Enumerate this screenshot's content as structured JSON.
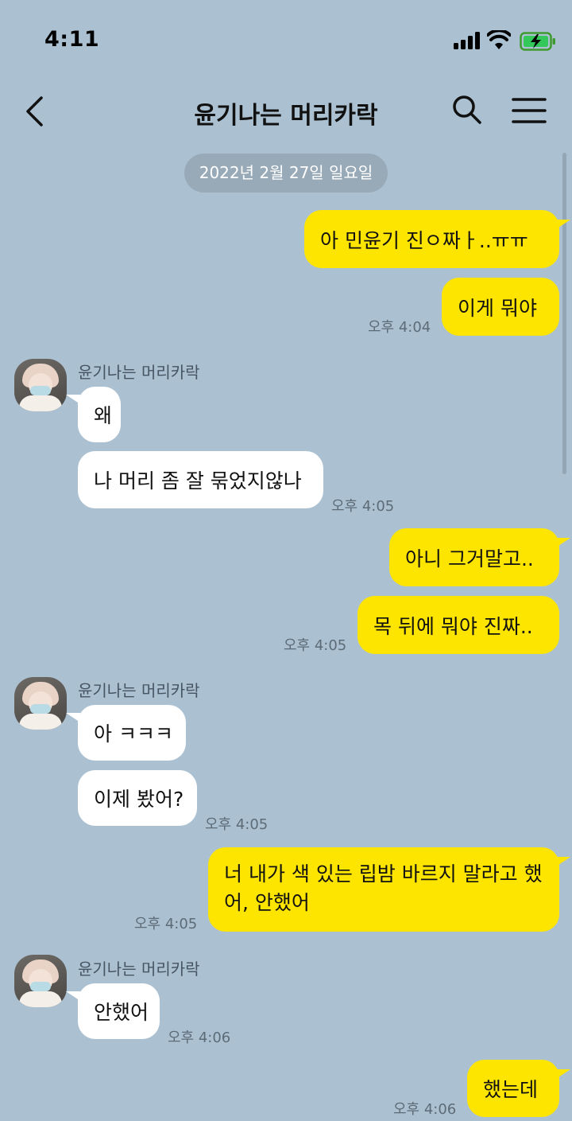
{
  "status_bar": {
    "time": "4:11"
  },
  "header": {
    "title": "윤기나는 머리카락"
  },
  "date_separator": "2022년 2월 27일 일요일",
  "messages": [
    {
      "from": "me",
      "text": "아 민윤기 진ㅇ짜ㅏ..ㅠㅠ"
    },
    {
      "from": "me",
      "text": "이게 뭐야",
      "time": "오후 4:04"
    },
    {
      "sender": "윤기나는 머리카락",
      "from": "them",
      "text": "왜"
    },
    {
      "from": "them",
      "text": "나 머리 좀 잘 묶었지않나",
      "time": "오후 4:05"
    },
    {
      "from": "me",
      "text": "아니 그거말고.."
    },
    {
      "from": "me",
      "text": "목 뒤에 뭐야 진짜..",
      "time": "오후 4:05"
    },
    {
      "sender": "윤기나는 머리카락",
      "from": "them",
      "text": "아 ㅋㅋㅋ"
    },
    {
      "from": "them",
      "text": "이제 봤어?",
      "time": "오후 4:05"
    },
    {
      "from": "me",
      "text": "너 내가 색 있는 립밤 바르지 말라고 했어, 안했어",
      "time": "오후 4:05"
    },
    {
      "sender": "윤기나는 머리카락",
      "from": "them",
      "text": "안했어",
      "time": "오후 4:06"
    },
    {
      "from": "me",
      "text": "했는데",
      "time": "오후 4:06"
    }
  ]
}
